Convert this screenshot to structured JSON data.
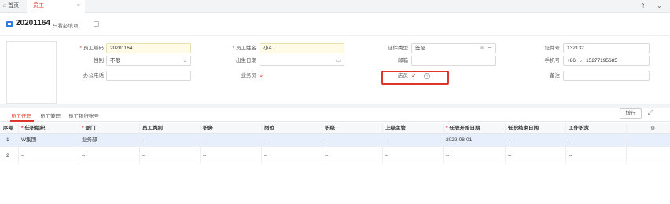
{
  "tabs": {
    "home": "⌂ 首页",
    "employee": "员工",
    "close": "×"
  },
  "toolbar": {
    "collapse": "⇑",
    "expand": "⌄"
  },
  "header": {
    "record_no": "20201164",
    "only_required": "只看必填项"
  },
  "form": {
    "emp_no": {
      "label": "员工编码",
      "value": "20201164"
    },
    "emp_name": {
      "label": "员工姓名",
      "value": "小A"
    },
    "id_type": {
      "label": "证件类型",
      "value": "签证"
    },
    "id_no": {
      "label": "证件号",
      "value": "132132"
    },
    "gender": {
      "label": "性别",
      "value": "不限"
    },
    "birth": {
      "label": "出生日期",
      "value": ""
    },
    "email": {
      "label": "邮箱",
      "value": ""
    },
    "mobile": {
      "label": "手机号",
      "prefix": "+86",
      "value": "15277195685"
    },
    "office_phone": {
      "label": "办公电话",
      "value": ""
    },
    "sales": {
      "label": "业务员",
      "mark": "✓"
    },
    "clerk": {
      "label": "店员",
      "mark": "✓",
      "info": "i"
    },
    "remark": {
      "label": "备注",
      "value": ""
    }
  },
  "subtabs": [
    "员工任职",
    "员工兼职",
    "员工银行账号"
  ],
  "buttons": {
    "add_row": "增行",
    "expand": "⤢"
  },
  "table": {
    "headers": [
      "序号",
      "任职组织",
      "部门",
      "员工类别",
      "职务",
      "岗位",
      "职级",
      "上级主管",
      "任职开始日期",
      "任职结束日期",
      "工作职责"
    ],
    "required": [
      false,
      true,
      true,
      false,
      false,
      false,
      false,
      false,
      true,
      false,
      false
    ],
    "rows": [
      [
        "1",
        "W集团",
        "业务部",
        "--",
        "--",
        "--",
        "--",
        "--",
        "2022-08-01",
        "--",
        "--"
      ],
      [
        "2",
        "--",
        "--",
        "--",
        "--",
        "--",
        "--",
        "--",
        "--",
        "--",
        "--"
      ]
    ]
  },
  "colors": {
    "accent": "#e0352b",
    "brand": "#2f7de1",
    "selected_row": "#e8effc"
  }
}
